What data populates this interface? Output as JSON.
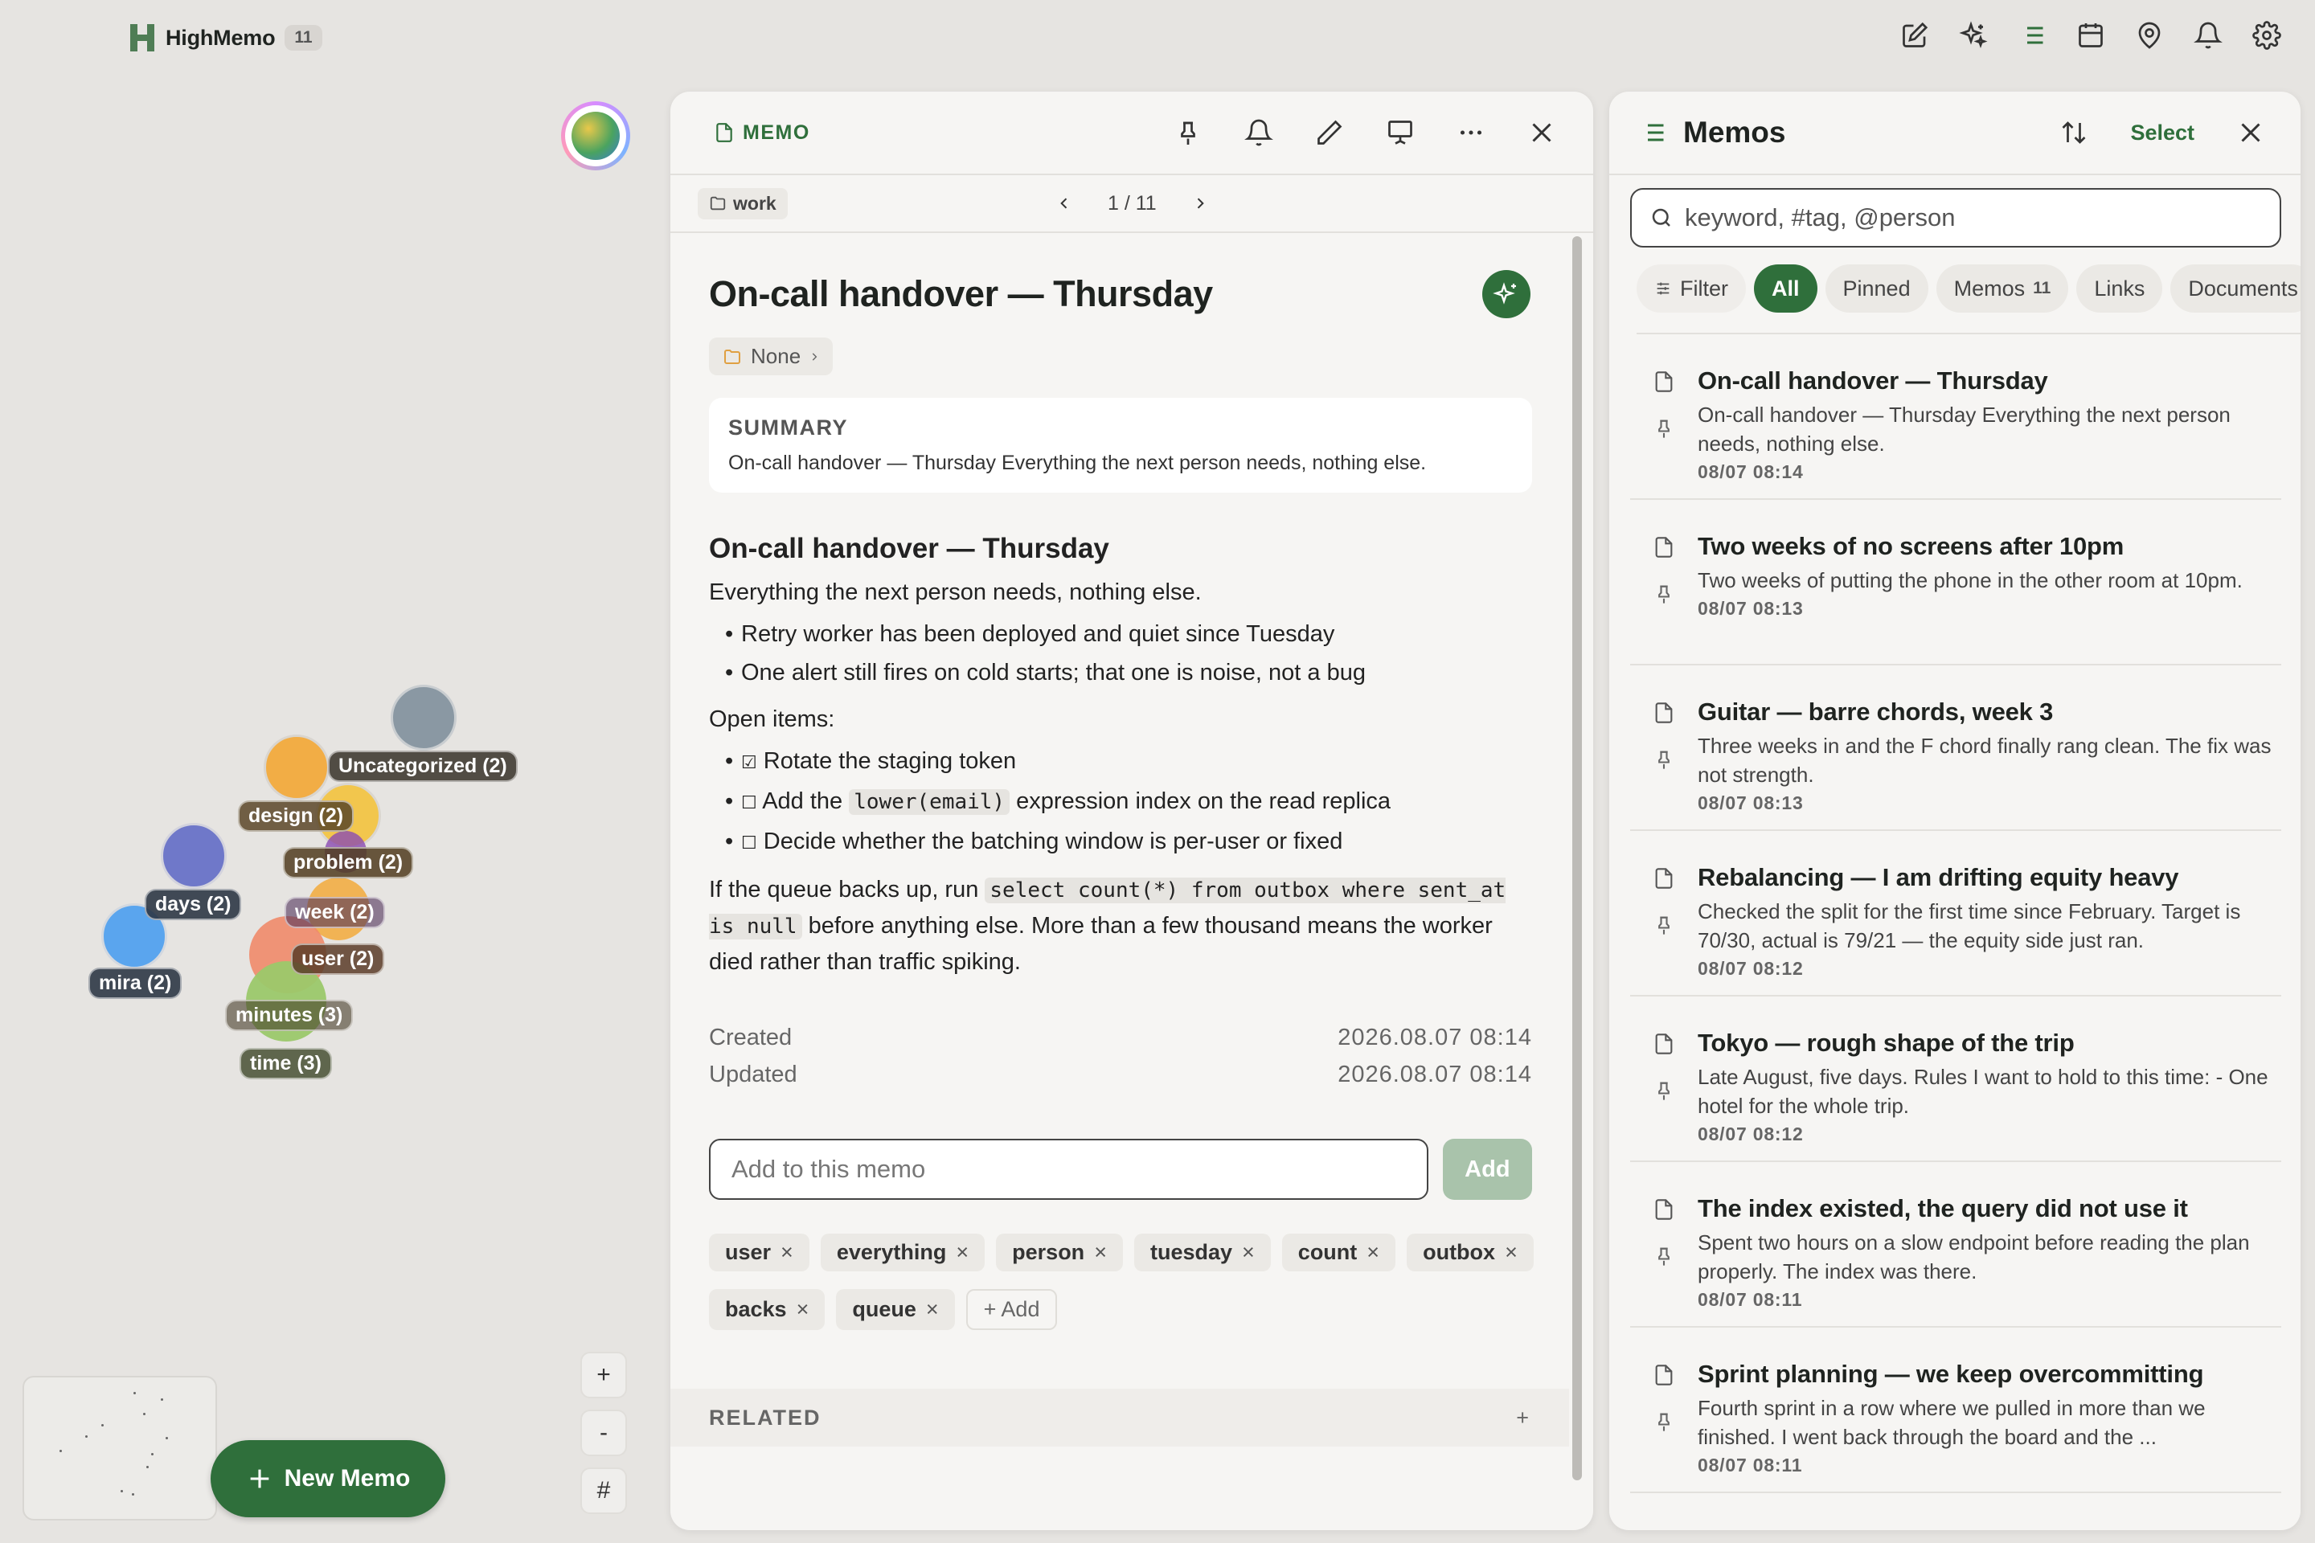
{
  "app": {
    "name": "HighMemo",
    "count": "11"
  },
  "topbar_icons": [
    "compose-icon",
    "sparkle-icon",
    "list-icon",
    "calendar-icon",
    "map-pin-icon",
    "bell-icon",
    "gear-icon"
  ],
  "graph": {
    "nodes": [
      {
        "label": "Uncategorized (2)",
        "color": "#8a98a3"
      },
      {
        "label": "design (2)",
        "color": "#f2ad45"
      },
      {
        "label": "problem (2)",
        "color": "#f4c33e"
      },
      {
        "label": "days (2)",
        "color": "#6f78c9"
      },
      {
        "label": "week (2)",
        "color": "#f2ad45"
      },
      {
        "label": "mira (2)",
        "color": "#5aa5ee"
      },
      {
        "label": "user (2)",
        "color": "#ef8a6a"
      },
      {
        "label": "minutes (3)",
        "color": "#9bc86a"
      },
      {
        "label": "time (3)",
        "color": "#9bc86a"
      }
    ],
    "zoom_in": "+",
    "zoom_out": "-",
    "hash": "#",
    "new_memo": "New Memo"
  },
  "memo": {
    "header_label": "MEMO",
    "folder": "work",
    "pager": "1 / 11",
    "title": "On-call handover — Thursday",
    "category": "None",
    "summary_label": "SUMMARY",
    "summary_text": "On-call handover — Thursday Everything the next person needs, nothing else.",
    "heading": "On-call handover — Thursday",
    "intro": "Everything the next person needs, nothing else.",
    "bullets": [
      "Retry worker has been deployed and quiet since Tuesday",
      "One alert still fires on cold starts; that one is noise, not a bug"
    ],
    "open_items_label": "Open items:",
    "todo1_box": "☑",
    "todo1": "Rotate the staging token",
    "todo2_box": "☐",
    "todo2_pre": "Add the",
    "todo2_code": "lower(email)",
    "todo2_post": "expression index on the read replica",
    "todo3_box": "☐",
    "todo3": "Decide whether the batching window is per-user or fixed",
    "para_pre": "If the queue backs up, run",
    "para_code": "select count(*) from outbox where sent_at is null",
    "para_post": "before anything else. More than a few thousand means the worker died rather than traffic spiking.",
    "created_label": "Created",
    "created_value": "2026.08.07 08:14",
    "updated_label": "Updated",
    "updated_value": "2026.08.07 08:14",
    "add_placeholder": "Add to this memo",
    "add_button": "Add",
    "tags": [
      "user",
      "everything",
      "person",
      "tuesday",
      "count",
      "outbox",
      "backs",
      "queue"
    ],
    "add_tag": "+ Add",
    "related_label": "RELATED",
    "related_add": "+"
  },
  "list": {
    "title": "Memos",
    "select": "Select",
    "search_placeholder": "keyword, #tag, @person",
    "filters": {
      "filter": "Filter",
      "all": "All",
      "pinned": "Pinned",
      "memos": "Memos",
      "memos_count": "11",
      "links": "Links",
      "documents": "Documents"
    },
    "items": [
      {
        "title": "On-call handover — Thursday",
        "preview": "On-call handover — Thursday Everything the next person needs, nothing else.",
        "date": "08/07 08:14"
      },
      {
        "title": "Two weeks of no screens after 10pm",
        "preview": "Two weeks of putting the phone in the other room at 10pm.",
        "date": "08/07 08:13"
      },
      {
        "title": "Guitar — barre chords, week 3",
        "preview": "Three weeks in and the F chord finally rang clean. The fix was not strength.",
        "date": "08/07 08:13"
      },
      {
        "title": "Rebalancing — I am drifting equity heavy",
        "preview": "Checked the split for the first time since February. Target is 70/30, actual is 79/21 — the equity side just ran.",
        "date": "08/07 08:12"
      },
      {
        "title": "Tokyo — rough shape of the trip",
        "preview": "Late August, five days. Rules I want to hold to this time: - One hotel for the whole trip.",
        "date": "08/07 08:12"
      },
      {
        "title": "The index existed, the query did not use it",
        "preview": "Spent two hours on a slow endpoint before reading the plan properly. The index was there.",
        "date": "08/07 08:11"
      },
      {
        "title": "Sprint planning — we keep overcommitting",
        "preview": "Fourth sprint in a row where we pulled in more than we finished. I went back through the board and the ...",
        "date": "08/07 08:11"
      }
    ]
  },
  "colors": {
    "accent": "#2f6f3b",
    "background": "#e6e4e1",
    "panel": "#f6f5f3"
  }
}
